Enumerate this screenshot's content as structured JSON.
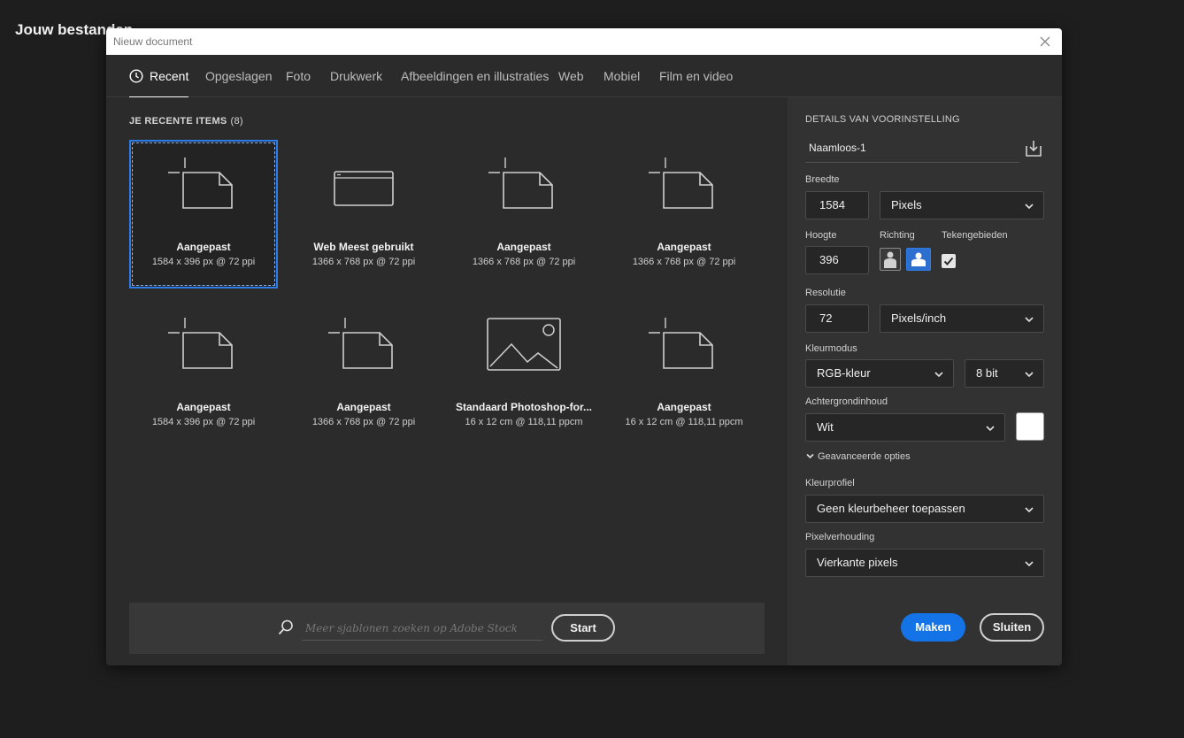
{
  "background": {
    "title": "Jouw bestanden"
  },
  "dialog": {
    "title": "Nieuw document"
  },
  "tabs": [
    {
      "label": "Recent",
      "active": true
    },
    {
      "label": "Opgeslagen"
    },
    {
      "label": "Foto"
    },
    {
      "label": "Drukwerk"
    },
    {
      "label": "Afbeeldingen en illustraties"
    },
    {
      "label": "Web"
    },
    {
      "label": "Mobiel"
    },
    {
      "label": "Film en video"
    }
  ],
  "recent": {
    "title": "JE RECENTE ITEMS",
    "count": "(8)",
    "items": [
      {
        "icon": "custom-document-icon",
        "name": "Aangepast",
        "meta": "1584 x 396 px @ 72 ppi",
        "selected": true
      },
      {
        "icon": "web-browser-icon",
        "name": "Web Meest gebruikt",
        "meta": "1366 x 768 px @ 72 ppi"
      },
      {
        "icon": "custom-document-icon",
        "name": "Aangepast",
        "meta": "1366 x 768 px @ 72 ppi"
      },
      {
        "icon": "custom-document-icon",
        "name": "Aangepast",
        "meta": "1366 x 768 px @ 72 ppi"
      },
      {
        "icon": "custom-document-icon",
        "name": "Aangepast",
        "meta": "1584 x 396 px @ 72 ppi"
      },
      {
        "icon": "custom-document-icon",
        "name": "Aangepast",
        "meta": "1366 x 768 px @ 72 ppi"
      },
      {
        "icon": "photo-icon",
        "name": "Standaard Photoshop-for...",
        "meta": "16 x 12 cm @ 118,11 ppcm"
      },
      {
        "icon": "custom-document-icon",
        "name": "Aangepast",
        "meta": "16 x 12 cm @ 118,11 ppcm"
      }
    ]
  },
  "search": {
    "placeholder": "Meer sjablonen zoeken op Adobe Stock",
    "button": "Start"
  },
  "preset": {
    "section_title": "DETAILS VAN VOORINSTELLING",
    "name": "Naamloos-1",
    "width_label": "Breedte",
    "width_value": "1584",
    "width_unit": "Pixels",
    "height_label": "Hoogte",
    "height_value": "396",
    "orientation_label": "Richting",
    "orientation_selected": "landscape",
    "artboards_label": "Tekengebieden",
    "artboards_checked": true,
    "resolution_label": "Resolutie",
    "resolution_value": "72",
    "resolution_unit": "Pixels/inch",
    "colormode_label": "Kleurmodus",
    "colormode_value": "RGB-kleur",
    "bitdepth_value": "8 bit",
    "background_label": "Achtergrondinhoud",
    "background_value": "Wit",
    "background_color": "#ffffff",
    "advanced_label": "Geavanceerde opties",
    "profile_label": "Kleurprofiel",
    "profile_value": "Geen kleurbeheer toepassen",
    "pixelratio_label": "Pixelverhouding",
    "pixelratio_value": "Vierkante pixels"
  },
  "actions": {
    "create": "Maken",
    "close": "Sluiten"
  },
  "colors": {
    "accent": "#1473e6",
    "selection": "#2d7ce8"
  }
}
